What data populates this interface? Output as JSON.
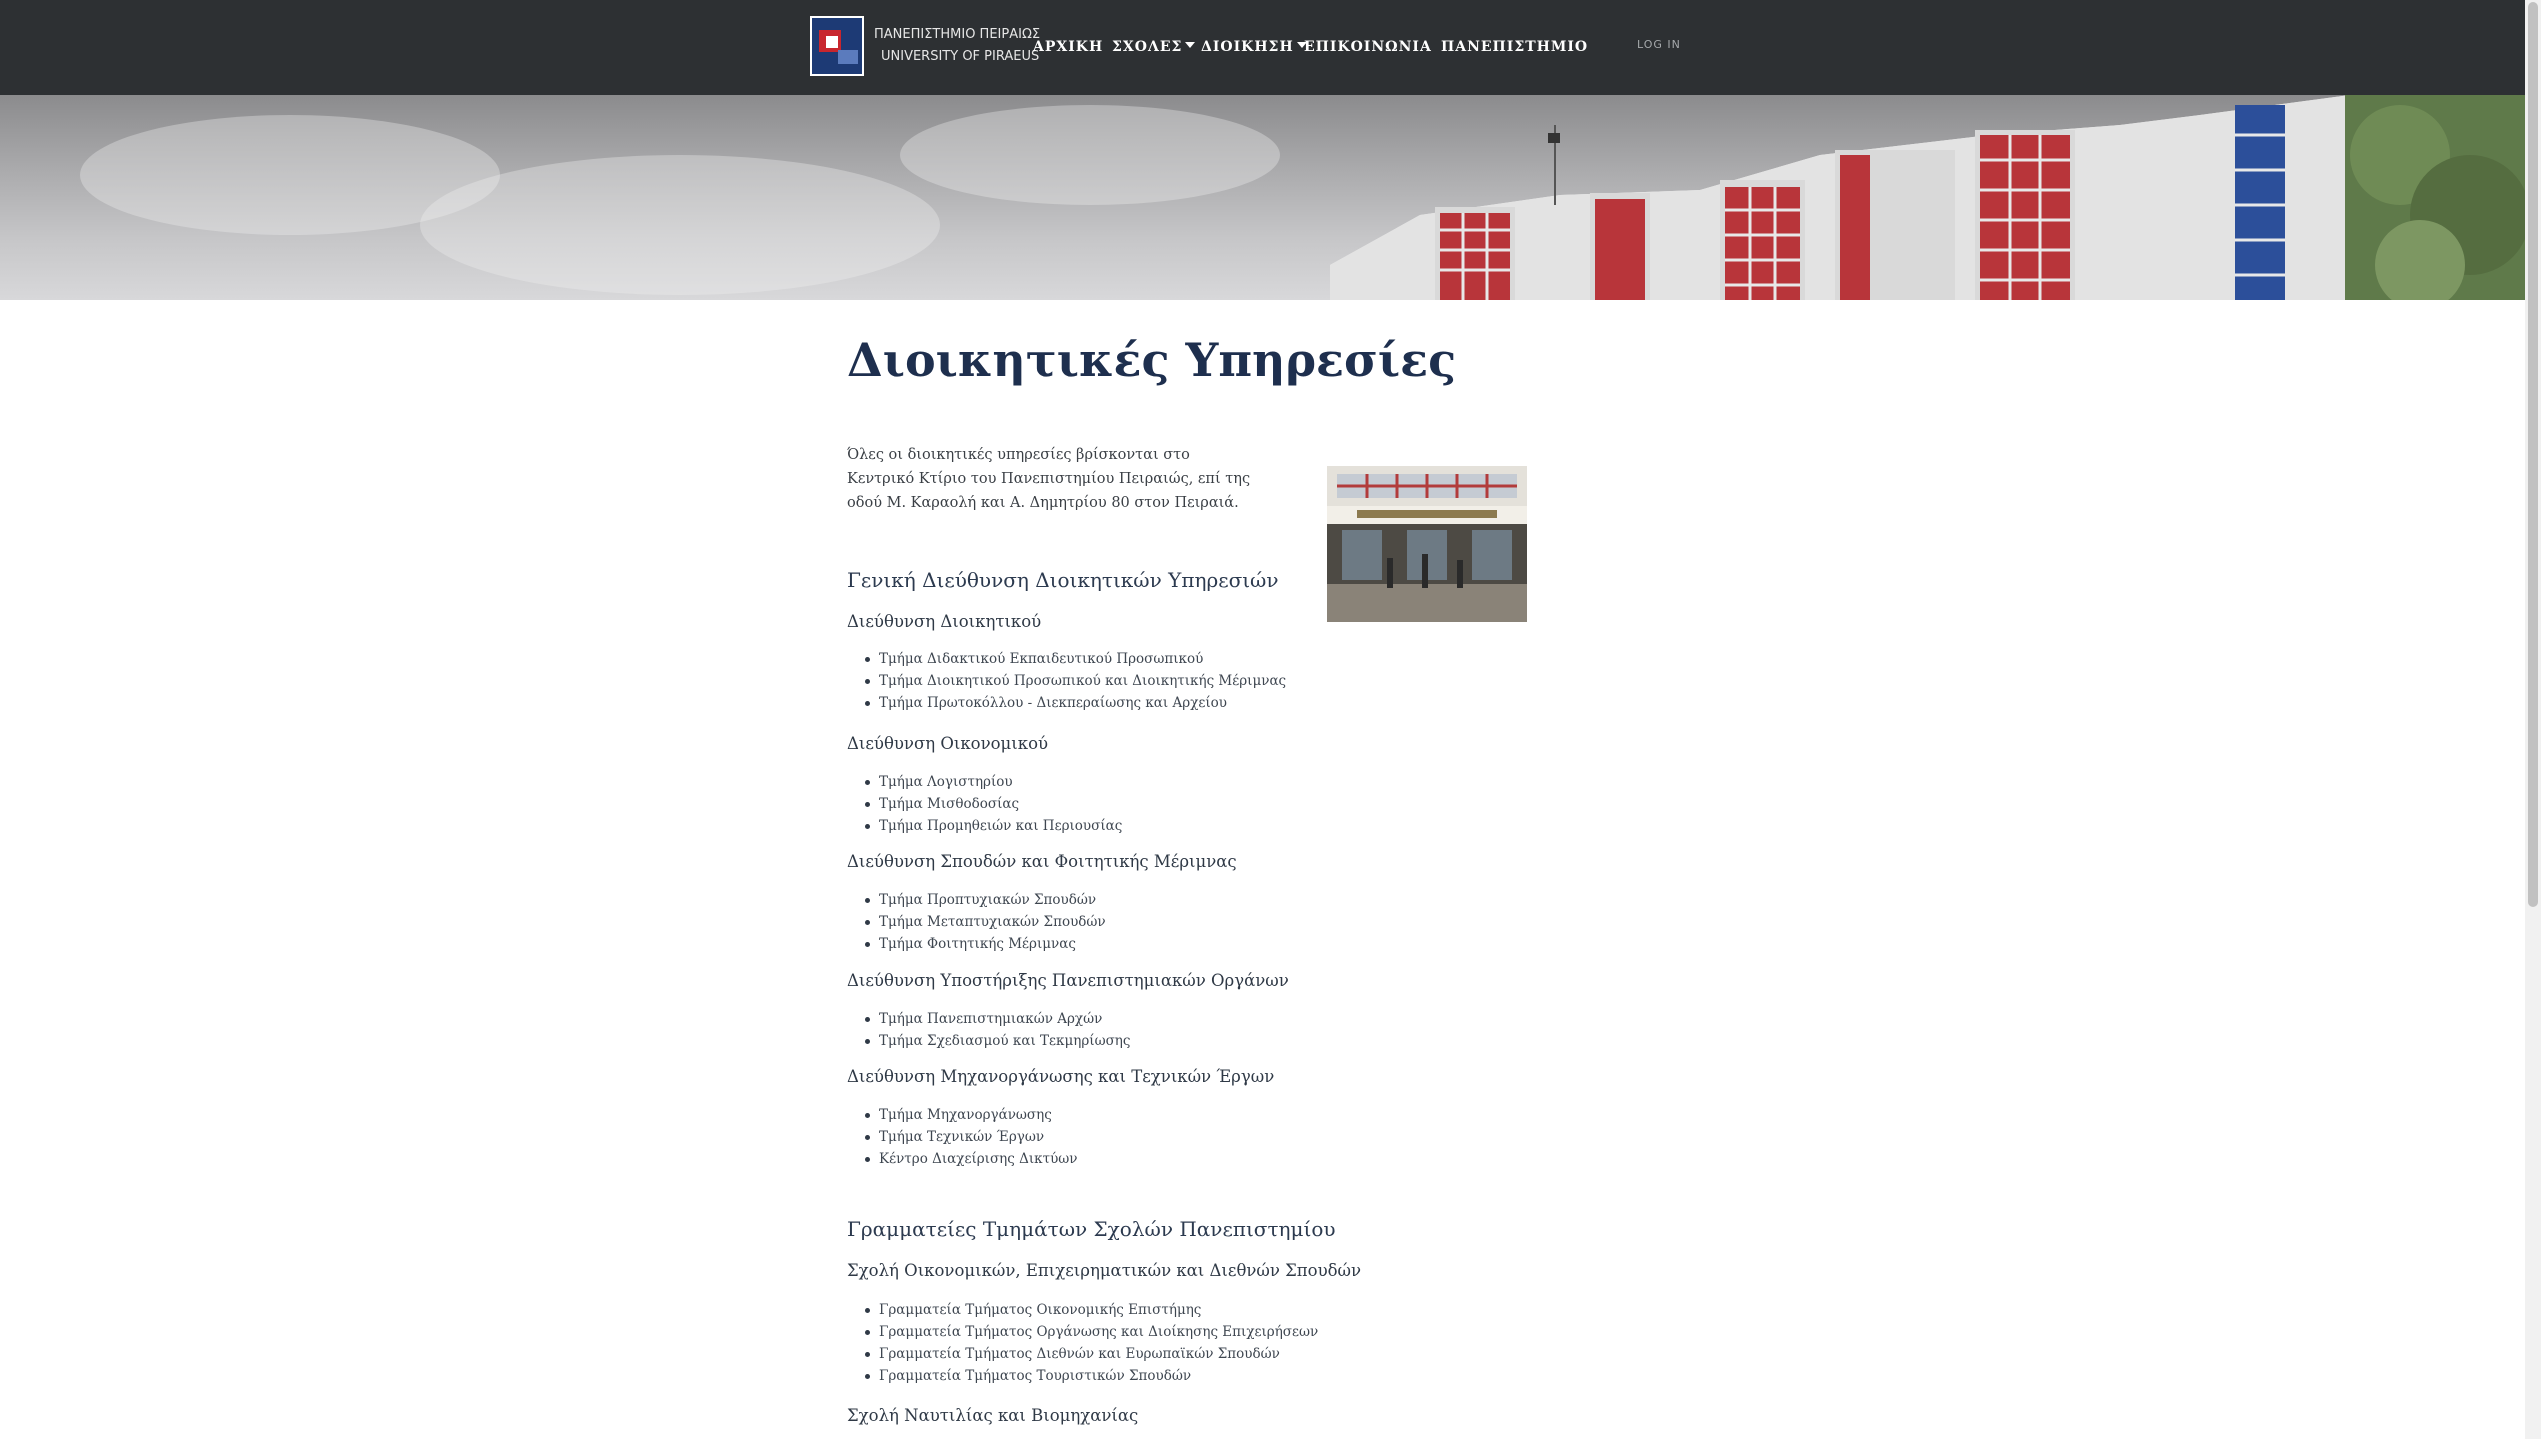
{
  "header": {
    "logo_alt": "University of Piraeus logo",
    "brand_line1": "ΠΑΝΕΠΙΣΤΗΜΙΟ ΠΕΙΡΑΙΩΣ",
    "brand_line2": "UNIVERSITY OF PIRAEUS",
    "nav": [
      {
        "label": "ΑΡΧΙΚΗ",
        "dropdown": false
      },
      {
        "label": "ΣΧΟΛΕΣ",
        "dropdown": true
      },
      {
        "label": "ΔΙΟΙΚΗΣΗ",
        "dropdown": true
      },
      {
        "label": "ΕΠΙΚΟΙΝΩΝΙΑ",
        "dropdown": false
      },
      {
        "label": "ΠΑΝΕΠΙΣΤΗΜΙΟ",
        "dropdown": false
      }
    ],
    "login_label": "LOG IN"
  },
  "page": {
    "title": "Διοικητικές Υπηρεσίες",
    "intro": "Όλες οι διοικητικές υπηρεσίες βρίσκονται στο Κεντρικό Κτίριο του Πανεπιστημίου Πειραιώς, επί της οδού Μ. Καραολή και Α. Δημητρίου 80 στον Πειραιά.",
    "sections": [
      {
        "heading": "Γενική Διεύθυνση Διοικητικών Υπηρεσιών",
        "groups": [
          {
            "title": "Διεύθυνση Διοικητικού",
            "items": [
              "Τμήμα Διδακτικού Εκπαιδευτικού Προσωπικού",
              "Τμήμα Διοικητικού Προσωπικού και Διοικητικής Μέριμνας",
              "Τμήμα Πρωτοκόλλου - Διεκπεραίωσης και Αρχείου"
            ]
          },
          {
            "title": "Διεύθυνση Οικονομικού",
            "items": [
              "Τμήμα Λογιστηρίου",
              "Τμήμα Μισθοδοσίας",
              "Τμήμα Προμηθειών και Περιουσίας"
            ]
          },
          {
            "title": "Διεύθυνση Σπουδών και Φοιτητικής Μέριμνας",
            "items": [
              "Τμήμα Προπτυχιακών Σπουδών",
              "Τμήμα Μεταπτυχιακών Σπουδών",
              "Τμήμα Φοιτητικής Μέριμνας"
            ]
          },
          {
            "title": "Διεύθυνση Υποστήριξης Πανεπιστημιακών Οργάνων",
            "items": [
              "Τμήμα Πανεπιστημιακών Αρχών",
              "Τμήμα Σχεδιασμού και Τεκμηρίωσης"
            ]
          },
          {
            "title": "Διεύθυνση Μηχανοργάνωσης και Τεχνικών Έργων",
            "items": [
              "Τμήμα Μηχανοργάνωσης",
              "Τμήμα Τεχνικών Έργων",
              "Κέντρο Διαχείρισης Δικτύων"
            ]
          }
        ]
      },
      {
        "heading": "Γραμματείες Τμημάτων Σχολών Πανεπιστημίου",
        "groups": [
          {
            "title": "Σχολή Οικονομικών, Επιχειρηματικών και Διεθνών Σπουδών",
            "items": [
              "Γραμματεία Τμήματος Οικονομικής Επιστήμης",
              "Γραμματεία Τμήματος Οργάνωσης και Διοίκησης Επιχειρήσεων",
              "Γραμματεία Τμήματος Διεθνών και Ευρωπαϊκών Σπουδών",
              "Γραμματεία Τμήματος Τουριστικών Σπουδών"
            ]
          },
          {
            "title": "Σχολή Ναυτιλίας και Βιομηχανίας",
            "items": []
          }
        ]
      }
    ]
  },
  "colors": {
    "navbar_bg": "#2d3033",
    "title_color": "#1e2f4e",
    "accent_red": "#c8262e",
    "accent_blue": "#1d3a75"
  }
}
